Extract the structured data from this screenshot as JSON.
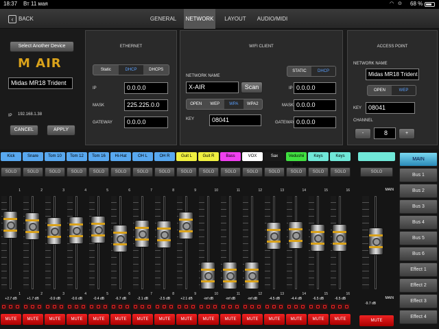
{
  "status": {
    "time": "18:37",
    "date": "Вт 11 мая",
    "battery": "68 %"
  },
  "nav": {
    "back": "BACK",
    "tabs": [
      "GENERAL",
      "NETWORK",
      "LAYOUT",
      "AUDIO/MIDI"
    ],
    "active": 1
  },
  "device": {
    "select_btn": "Select Another Device",
    "logo": "M AIR",
    "name": "Midas MR18 Trident",
    "ip_label": "IP",
    "ip": "192.168.1.38",
    "cancel": "CANCEL",
    "apply": "APPLY"
  },
  "ethernet": {
    "title": "ETHERNET",
    "modes": [
      "Static",
      "DHCP",
      "DHCPS"
    ],
    "active_mode": 1,
    "ip_label": "IP",
    "ip": "0.0.0.0",
    "mask_label": "MASK",
    "mask": "225.225.0.0",
    "gateway_label": "GATEWAY",
    "gateway": "0.0.0.0"
  },
  "wifi": {
    "title": "WIFI CLIENT",
    "network_label": "NETWORK NAME",
    "network": "X-AIR",
    "scan": "Scan",
    "security": [
      "OPEN",
      "WEP",
      "WPA",
      "WPA2"
    ],
    "active_security": 2,
    "key_label": "KEY",
    "key": "08041",
    "modes": [
      "STATIC",
      "DHCP"
    ],
    "active_mode": 1,
    "ip_label": "IP",
    "ip": "0.0.0.0",
    "mask_label": "MASK",
    "mask": "0.0.0.0",
    "gateway_label": "GATEWAY",
    "gateway": "0.0.0.0"
  },
  "ap": {
    "title": "ACCESS POINT",
    "network_label": "NETWORK NAME",
    "network": "Midas MR18 Trident",
    "security": [
      "OPEN",
      "WEP"
    ],
    "active_security": 1,
    "key_label": "KEY",
    "key": "08041",
    "channel_label": "CHANNEL",
    "minus": "-",
    "channel": "8",
    "plus": "+"
  },
  "mixer": {
    "solo": "SOLO",
    "mute": "MUTE",
    "channels": [
      {
        "name": "Kick",
        "num": "1",
        "db": "+2.7 dB",
        "color": "#58a8f0",
        "fader": 0.77
      },
      {
        "name": "Snare",
        "num": "2",
        "db": "+1.7 dB",
        "color": "#58a8f0",
        "fader": 0.75
      },
      {
        "name": "Tom 10",
        "num": "3",
        "db": "-0.9 dB",
        "color": "#58a8f0",
        "fader": 0.68
      },
      {
        "name": "Tom 12",
        "num": "4",
        "db": "-0.6 dB",
        "color": "#58a8f0",
        "fader": 0.69
      },
      {
        "name": "Tom 16",
        "num": "5",
        "db": "-0.4 dB",
        "color": "#58a8f0",
        "fader": 0.7
      },
      {
        "name": "Hi-Hat",
        "num": "6",
        "db": "-6.7 dB",
        "color": "#58a8f0",
        "fader": 0.56
      },
      {
        "name": "OH L",
        "num": "7",
        "db": "-2.1 dB",
        "color": "#58a8f0",
        "fader": 0.64
      },
      {
        "name": "OH R",
        "num": "8",
        "db": "-2.5 dB",
        "color": "#58a8f0",
        "fader": 0.63
      },
      {
        "name": "Guit L",
        "num": "9",
        "db": "+2.1 dB",
        "color": "#f0f040",
        "fader": 0.76
      },
      {
        "name": "Guit R",
        "num": "10",
        "db": "-inf dB",
        "color": "#f0f040",
        "fader": 0
      },
      {
        "name": "Bass",
        "num": "11",
        "db": "-inf dB",
        "color": "#f040f0",
        "fader": 0
      },
      {
        "name": "VOX",
        "num": "12",
        "db": "-inf dB",
        "color": "#ffffff",
        "fader": 0
      },
      {
        "name": "Sax",
        "num": "13",
        "db": "-4.5 dB",
        "color": "#1a1a1a",
        "fader": 0.6
      },
      {
        "name": "Vedushii 8SS",
        "num": "14",
        "db": "-4.4 dB",
        "color": "#40e040",
        "fader": 0.61
      },
      {
        "name": "Keys",
        "num": "15",
        "db": "-6.5 dB",
        "color": "#70e8d8",
        "fader": 0.57
      },
      {
        "name": "Keys",
        "num": "16",
        "db": "-6.5 dB",
        "color": "#70e8d8",
        "fader": 0.57
      }
    ],
    "main": {
      "label_top": "MAIN",
      "label_bottom": "MAIN",
      "db": "-9.7 dB",
      "solo": "SOLO",
      "mute": "MUTE",
      "fader": 0.52
    },
    "buses": [
      "MAIN",
      "Bus 1",
      "Bus 2",
      "Bus 3",
      "Bus 4",
      "Bus 5",
      "Bus 6",
      "Effect 1",
      "Effect 2",
      "Effect 3",
      "Effect 4"
    ],
    "active_bus": 0
  }
}
